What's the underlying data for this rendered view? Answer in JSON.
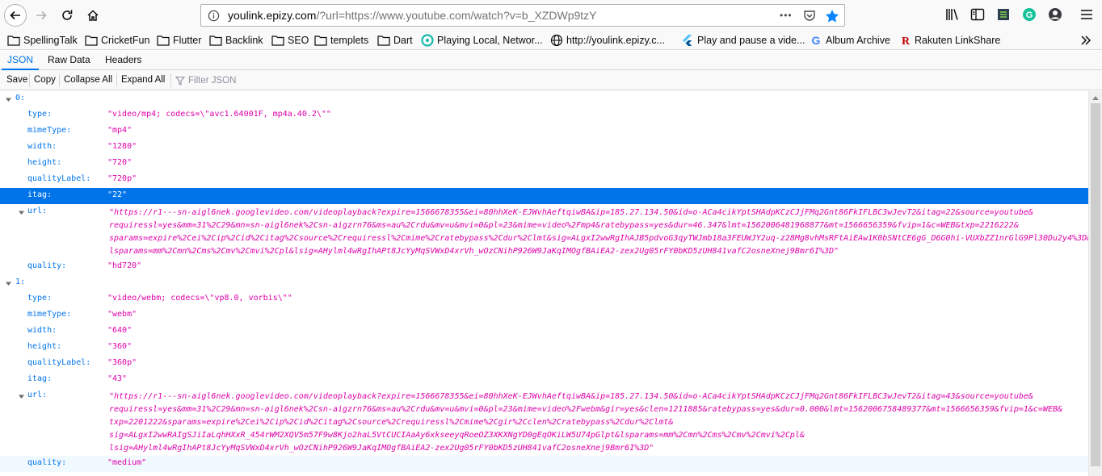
{
  "navbar": {
    "url_host": "youlink.epizy.com",
    "url_rest": "/?url=https://www.youtube.com/watch?v=b_XZDWp9tzY",
    "page_actions": "•••"
  },
  "bookmarks": [
    {
      "label": "SpellingTalk",
      "icon": "folder-icon"
    },
    {
      "label": "CricketFun",
      "icon": "folder-icon"
    },
    {
      "label": "Flutter",
      "icon": "folder-icon"
    },
    {
      "label": "Backlink",
      "icon": "folder-icon"
    },
    {
      "label": "SEO",
      "icon": "folder-icon"
    },
    {
      "label": "templets",
      "icon": "folder-icon"
    },
    {
      "label": "Dart",
      "icon": "folder-icon"
    },
    {
      "label": "Playing Local, Networ...",
      "icon": "site-favicon"
    },
    {
      "label": "http://youlink.epizy.c...",
      "icon": "globe-icon"
    },
    {
      "label": "Play and pause a vide...",
      "icon": "flutter-favicon"
    },
    {
      "label": "Album Archive",
      "icon": "google-favicon"
    },
    {
      "label": "Rakuten LinkShare",
      "icon": "rakuten-favicon"
    }
  ],
  "viewer_tabs": [
    "JSON",
    "Raw Data",
    "Headers"
  ],
  "toolbar": {
    "save": "Save",
    "copy": "Copy",
    "collapse_all": "Collapse All",
    "expand_all": "Expand All",
    "filter_placeholder": "Filter JSON"
  },
  "json_tree": {
    "item0": {
      "key": "0:",
      "type_key": "type:",
      "type_val": "\"video/mp4; codecs=\\\"avc1.64001F, mp4a.40.2\\\"\"",
      "mime_key": "mimeType:",
      "mime_val": "\"mp4\"",
      "width_key": "width:",
      "width_val": "\"1280\"",
      "height_key": "height:",
      "height_val": "\"720\"",
      "ql_key": "qualityLabel:",
      "ql_val": "\"720p\"",
      "itag_key": "itag:",
      "itag_val": "\"22\"",
      "url_key": "url:",
      "url_lines": [
        "\"https://r1---sn-aigl6nek.googlevideo.com/videoplayback?expire=1566678355&ei=80hhXeK-EJWvhAeftqiwBA&ip=185.27.134.50&id=o-ACa4cikYptSHAdpKCzCJjFMq2Gnt86FkIFLBC3wJevT2&itag=22&source=youtube&",
        "requiressl=yes&mm=31%2C29&mn=sn-aigl6nek%2Csn-aigzrn76&ms=au%2Crdu&mv=u&mvi=0&pl=23&mime=video%2Fmp4&ratebypass=yes&dur=46.347&lmt=1562006481968877&mt=1566656359&fvip=1&c=WEB&txp=2216222&",
        "sparams=expire%2Cei%2Cip%2Cid%2Citag%2Csource%2Crequiressl%2Cmime%2Cratebypass%2Cdur%2Clmt&sig=ALgxI2wwRgIhAJB5pdvoG3qyTWJmb18a3FEUWJY2uq-z28Mg8vhMsRFtAiEAw1K0bSNtCE6gG_D6G0hi-VUXbZZ1nrGlG9Pl30Du2y4%3D&",
        "lsparams=mm%2Cmn%2Cms%2Cmv%2Cmvi%2Cpl&lsig=AHylml4wRgIhAPt8JcYyMqSVWxD4xrVh_wOzCNihP926W9JaKqIMOgfBAiEA2-zex2Ug05rFY0bKD5zUH841vafC2osneXnej9Bmr6I%3D\""
      ],
      "quality_key": "quality:",
      "quality_val": "\"hd720\""
    },
    "item1": {
      "key": "1:",
      "type_key": "type:",
      "type_val": "\"video/webm; codecs=\\\"vp8.0, vorbis\\\"\"",
      "mime_key": "mimeType:",
      "mime_val": "\"webm\"",
      "width_key": "width:",
      "width_val": "\"640\"",
      "height_key": "height:",
      "height_val": "\"360\"",
      "ql_key": "qualityLabel:",
      "ql_val": "\"360p\"",
      "itag_key": "itag:",
      "itag_val": "\"43\"",
      "url_key": "url:",
      "url_lines": [
        "\"https://r1---sn-aigl6nek.googlevideo.com/videoplayback?expire=1566678355&ei=80hhXeK-EJWvhAeftqiwBA&ip=185.27.134.50&id=o-ACa4cikYptSHAdpKCzCJjFMq2Gnt86FkIFLBC3wJevT2&itag=43&source=youtube&",
        "requiressl=yes&mm=31%2C29&mn=sn-aigl6nek%2Csn-aigzrn76&ms=au%2Crdu&mv=u&mvi=0&pl=23&mime=video%2Fwebm&gir=yes&clen=1211885&ratebypass=yes&dur=0.000&lmt=1562006758489377&mt=1566656359&fvip=1&c=WEB&",
        "txp=2201222&sparams=expire%2Cei%2Cip%2Cid%2Citag%2Csource%2Crequiressl%2Cmime%2Cgir%2Cclen%2Cratebypass%2Cdur%2Clmt&",
        "sig=ALgxI2wwRAIgSJiIaLqhHXxR_454rWM2XQV5m57F9w8Kjo2haL5VtCUCIAaAy6xkseeyqRoeOZ3XKXNgYD0gEqOKiLW5U74pGlpt&lsparams=mm%2Cmn%2Cms%2Cmv%2Cmvi%2Cpl&",
        "lsig=AHylml4wRgIhAPt8JcYyMqSVWxD4xrVh_wOzCNihP926W9JaKqIMOgfBAiEA2-zex2Ug05rFY0bKD5zUH841vafC2osneXnej9Bmr6I%3D\""
      ],
      "quality_key": "quality:",
      "quality_val": "\"medium\""
    }
  },
  "colors": {
    "key": "#0074e8",
    "string_value": "#dd00a9",
    "selection": "#0074e8",
    "hover_row": "#f0f9fe"
  }
}
